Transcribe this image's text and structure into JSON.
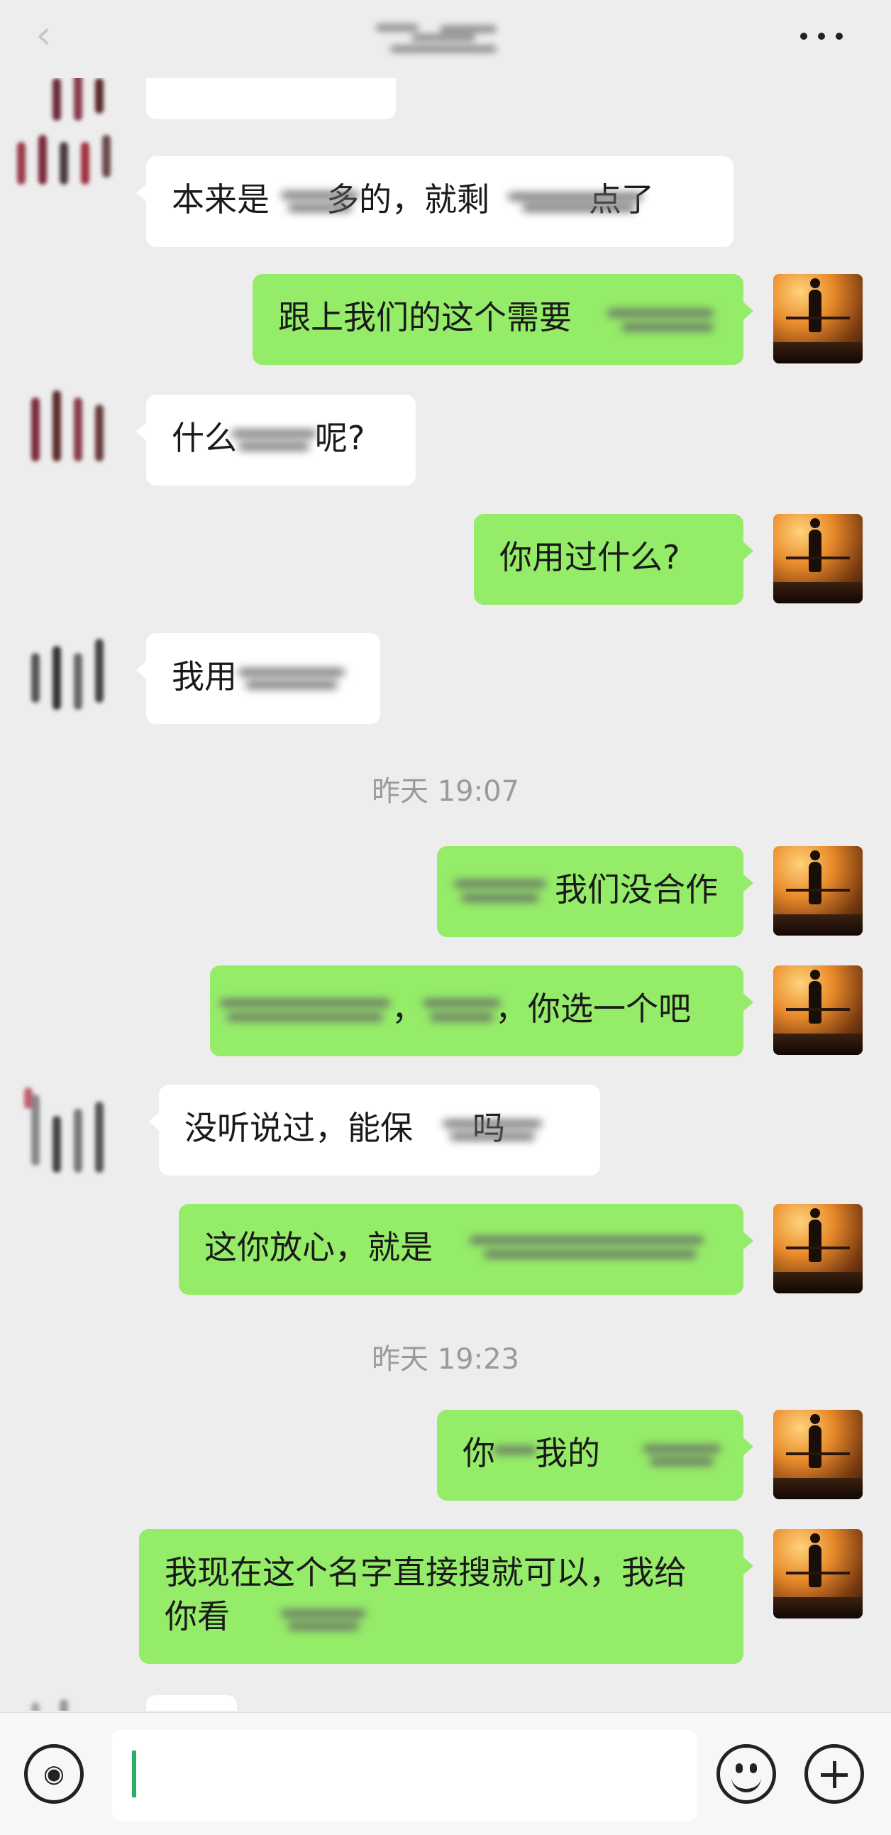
{
  "header": {
    "title": "",
    "back_icon": "chevron-left-icon",
    "more_icon": "more-dots-icon"
  },
  "messages": [
    {
      "side": "left",
      "text": "本来是",
      "text2": "多的，就剩",
      "text3": "点了"
    },
    {
      "side": "right",
      "text": "跟上我们的这个需要"
    },
    {
      "side": "left",
      "text": "什么",
      "text2": "呢?"
    },
    {
      "side": "right",
      "text": "你用过什么?"
    },
    {
      "side": "left",
      "text": "我用"
    },
    {
      "side": "right",
      "text": "我们没合作"
    },
    {
      "side": "right",
      "text": "，",
      "text2": "，你选一个吧"
    },
    {
      "side": "left",
      "text": "没听说过，能保",
      "text2": "吗"
    },
    {
      "side": "right",
      "text": "这你放心，就是"
    },
    {
      "side": "right",
      "text": "你",
      "text2": "我的"
    },
    {
      "side": "right",
      "text": "我现在这个名字直接搜就可以，我给你看"
    }
  ],
  "timestamps": [
    "昨天 19:07",
    "昨天 19:23"
  ],
  "input": {
    "value": "",
    "voice_icon": "voice-icon",
    "emoji_icon": "emoji-icon",
    "plus_icon": "plus-icon"
  }
}
